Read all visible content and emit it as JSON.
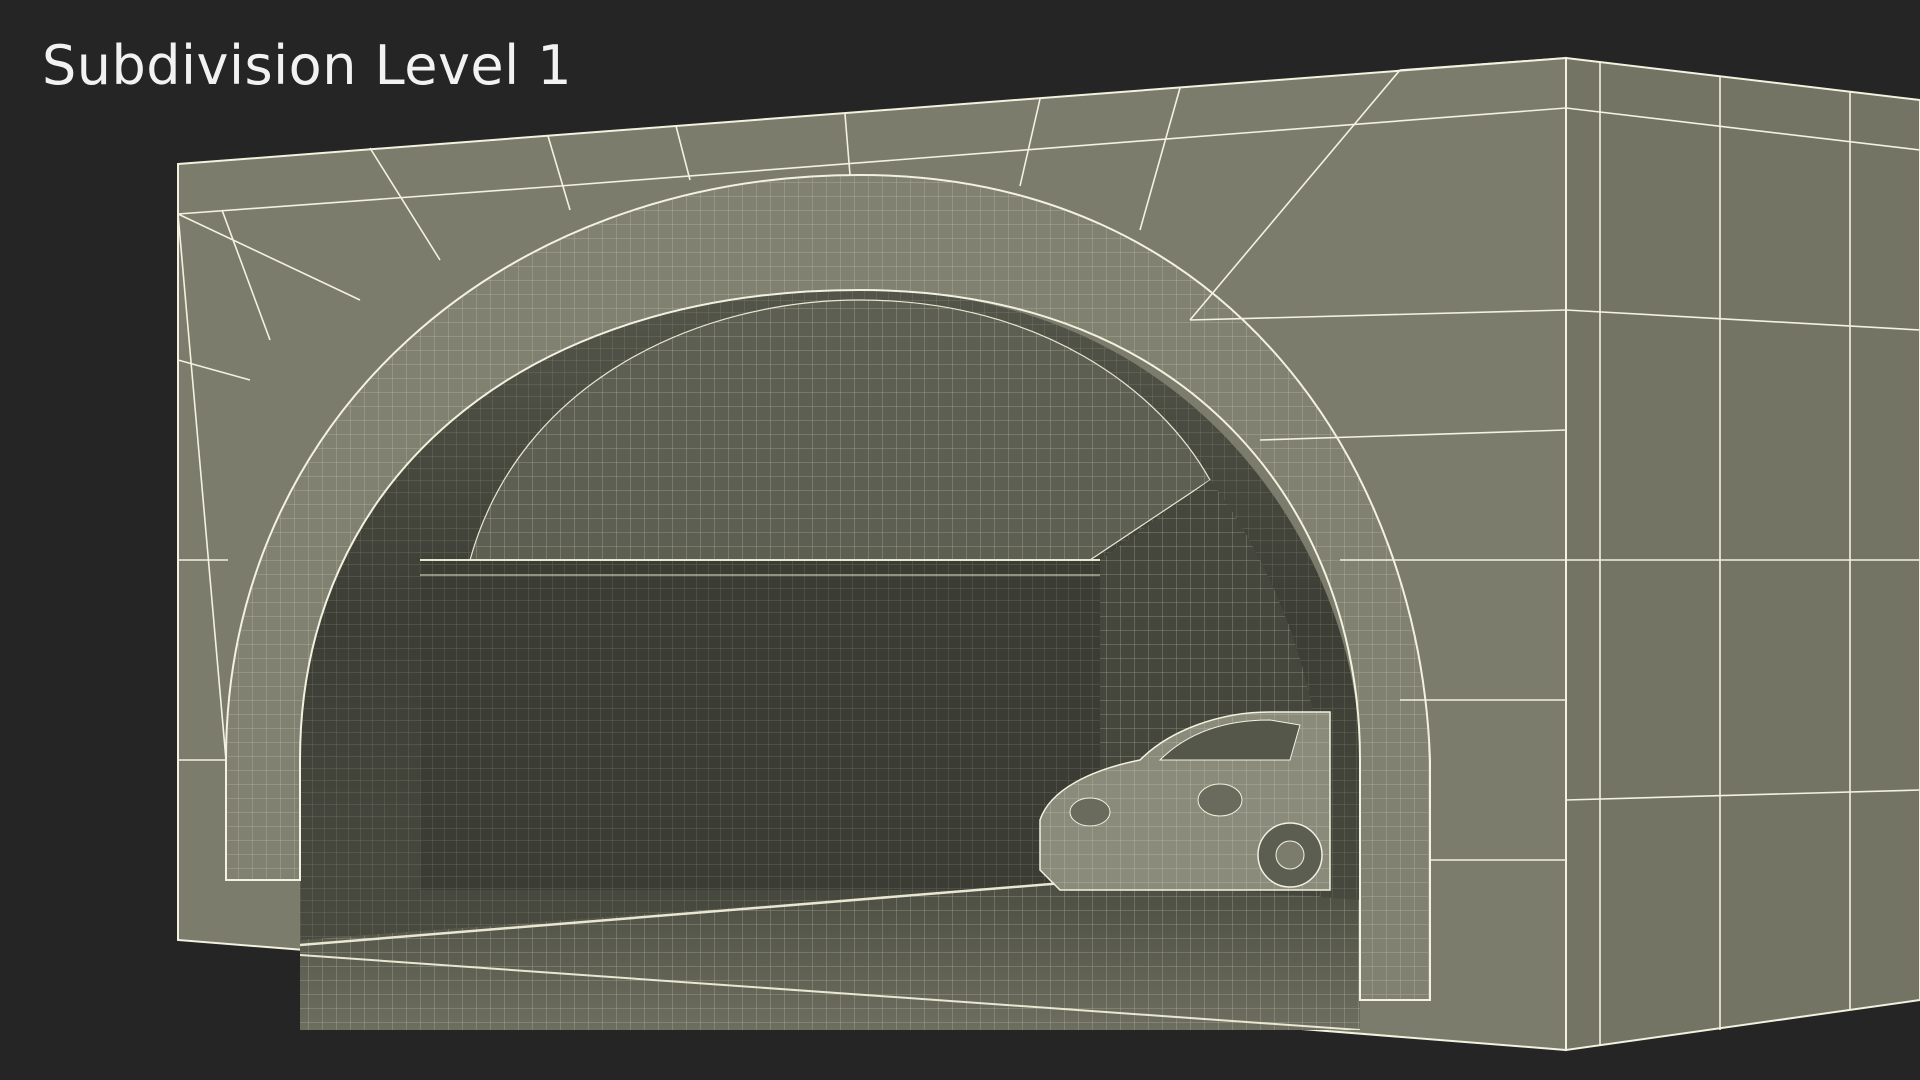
{
  "render": {
    "caption": "Subdivision Level 1"
  },
  "colors": {
    "background": "#252525",
    "mesh_face": "#7a7b6b",
    "mesh_side": "#747565",
    "interior": "#3a3c34",
    "wire": "#f3f1df"
  }
}
